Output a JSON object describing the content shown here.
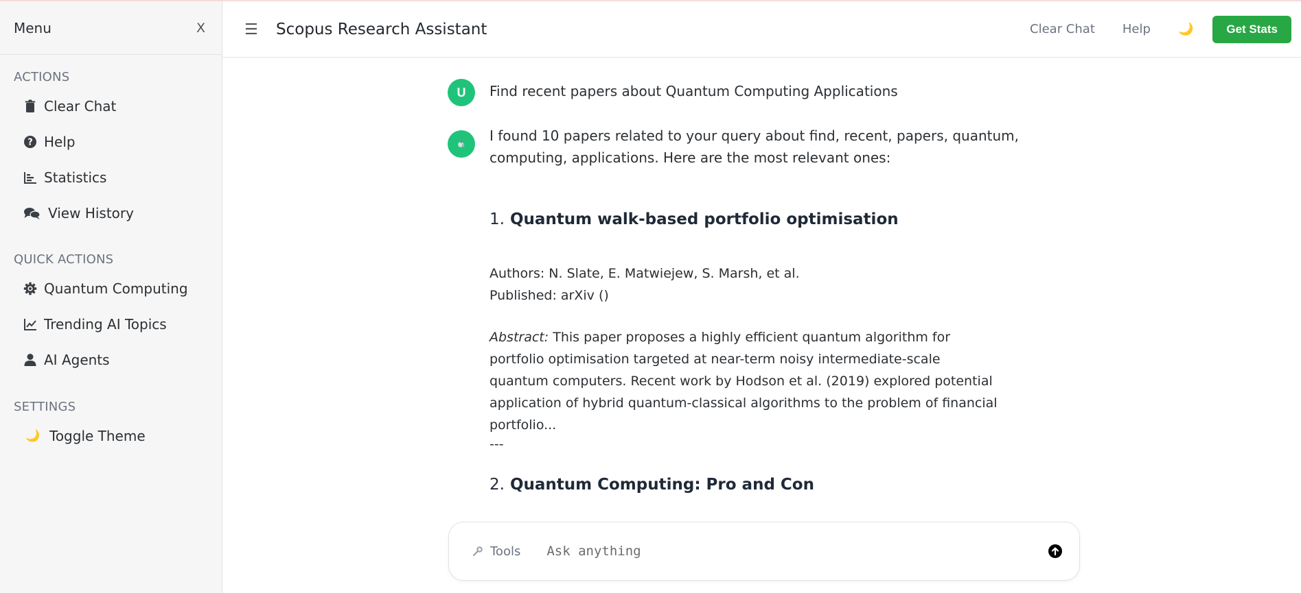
{
  "sidebar": {
    "title": "Menu",
    "close_label": "X",
    "sections": {
      "actions": {
        "title": "ACTIONS",
        "items": [
          {
            "label": "Clear Chat",
            "icon": "trash-icon"
          },
          {
            "label": "Help",
            "icon": "question-circle-icon"
          },
          {
            "label": "Statistics",
            "icon": "bar-chart-icon"
          },
          {
            "label": "View History",
            "icon": "comments-icon"
          }
        ]
      },
      "quick": {
        "title": "QUICK ACTIONS",
        "items": [
          {
            "label": "Quantum Computing",
            "icon": "gear-icon"
          },
          {
            "label": "Trending AI Topics",
            "icon": "line-chart-icon"
          },
          {
            "label": "AI Agents",
            "icon": "user-icon"
          }
        ]
      },
      "settings": {
        "title": "SETTINGS",
        "items": [
          {
            "label": "Toggle Theme",
            "icon": "moon-icon",
            "glyph": "🌙"
          }
        ]
      }
    }
  },
  "header": {
    "menu_glyph": "☰",
    "title": "Scopus Research Assistant",
    "clear_chat": "Clear Chat",
    "help": "Help",
    "theme_glyph": "🌙",
    "stats_button": "Get Stats"
  },
  "chat": {
    "user_avatar": "U",
    "user_message": "Find recent papers about Quantum Computing Applications",
    "bot_intro": "I found 10 papers related to your query about find, recent, papers, quantum, computing, applications. Here are the most relevant ones:",
    "papers": [
      {
        "number": "1.",
        "title": "Quantum walk-based portfolio optimisation",
        "authors": "Authors: N. Slate, E. Matwiejew, S. Marsh, et al.",
        "published": "Published: arXiv ()",
        "abstract_label": "Abstract:",
        "abstract": " This paper proposes a highly efficient quantum algorithm for portfolio optimisation targeted at near-term noisy intermediate-scale quantum computers. Recent work by Hodson et al. (2019) explored potential application of hybrid quantum-classical algorithms to the problem of financial portfolio..."
      },
      {
        "number": "2.",
        "title": "Quantum Computing: Pro and Con"
      }
    ],
    "separator": "---"
  },
  "input": {
    "tools_label": "Tools",
    "placeholder": "Ask anything"
  },
  "colors": {
    "accent_green": "#28a745",
    "avatar_green": "#20c37a"
  }
}
